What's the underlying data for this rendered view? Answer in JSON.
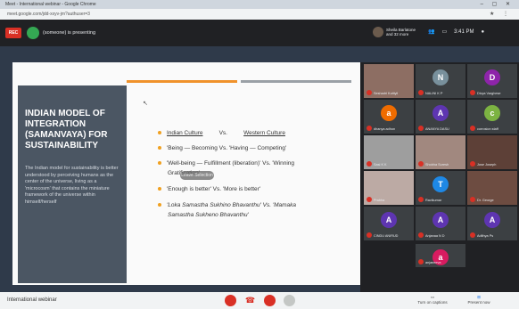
{
  "browser": {
    "title": "Meet - International webinar - Google Chrome",
    "url": "meet.google.com/jdd-xxyv-jm?authuser=3"
  },
  "meet": {
    "rec_label": "REC",
    "presenting_text": "(someone) is presenting",
    "host_name": "Sheila Barlatone and 32 more",
    "time": "3:41 PM"
  },
  "slide": {
    "sidebar_title_1": "INDIAN MODEL OF INTEGRATION",
    "sidebar_title_2": "(SAMANVAYA) FOR SUSTAINABILITY",
    "sidebar_body": "The Indian model for sustainability is better understood by perceiving humans as the center of the universe, living as a 'microcosm' that contains the miniature framework of the universe within himself/herself",
    "pointer": "↖",
    "header_left": "Indian Culture",
    "header_vs": "Vs.",
    "header_right": "Western Culture",
    "bullets": [
      "'Being — Becoming      Vs.  'Having — Competing'",
      "'Well-being — Fulfillment (liberation)'   Vs.    'Winning",
      "'Enough is better'    Vs. 'More is better'",
      "'Loka Samastha Sukhino Bhavanthu'    Vs.    'Mamaka",
      "Samastha Sukheno Bhavanthu'"
    ],
    "bullet2_cont": "Gratification'",
    "tooltip": "Leave Selection"
  },
  "participants": [
    {
      "name": "Seshadri Kuttiyil",
      "initial": "",
      "color": "#8d6e63",
      "video": true
    },
    {
      "name": "NALINI K P",
      "initial": "N",
      "color": "#78909c"
    },
    {
      "name": "Divya Varghese",
      "initial": "D",
      "color": "#8e24aa"
    },
    {
      "name": "dhanya adhon",
      "initial": "a",
      "color": "#ef6c00"
    },
    {
      "name": "ANANYA DASU",
      "initial": "A",
      "color": "#5e35b1"
    },
    {
      "name": "corrosion staff",
      "initial": "c",
      "color": "#7cb342"
    },
    {
      "name": "Sasi K K",
      "initial": "",
      "color": "#9e9e9e",
      "video": true
    },
    {
      "name": "Shobha Suresh",
      "initial": "",
      "color": "#a1887f",
      "video": true
    },
    {
      "name": "Jose Joseph",
      "initial": "",
      "color": "#5d4037",
      "video": true
    },
    {
      "name": "Prabha",
      "initial": "",
      "color": "#bcaaa4",
      "video": true
    },
    {
      "name": "Ravikumar",
      "initial": "T",
      "color": "#1e88e5"
    },
    {
      "name": "Dr. George",
      "initial": "",
      "color": "#6d4c41",
      "video": true
    },
    {
      "name": "CINDU ANIRUD",
      "initial": "A",
      "color": "#5e35b1"
    },
    {
      "name": "Anjanaa N D",
      "initial": "A",
      "color": "#5e35b1"
    },
    {
      "name": "Adithya Ps",
      "initial": "A",
      "color": "#5e35b1"
    },
    {
      "name": "anjaneeva",
      "initial": "a",
      "color": "#d81b60"
    }
  ],
  "bottom": {
    "meeting_name": "International webinar",
    "captions": "Turn on captions",
    "present": "Present now"
  }
}
